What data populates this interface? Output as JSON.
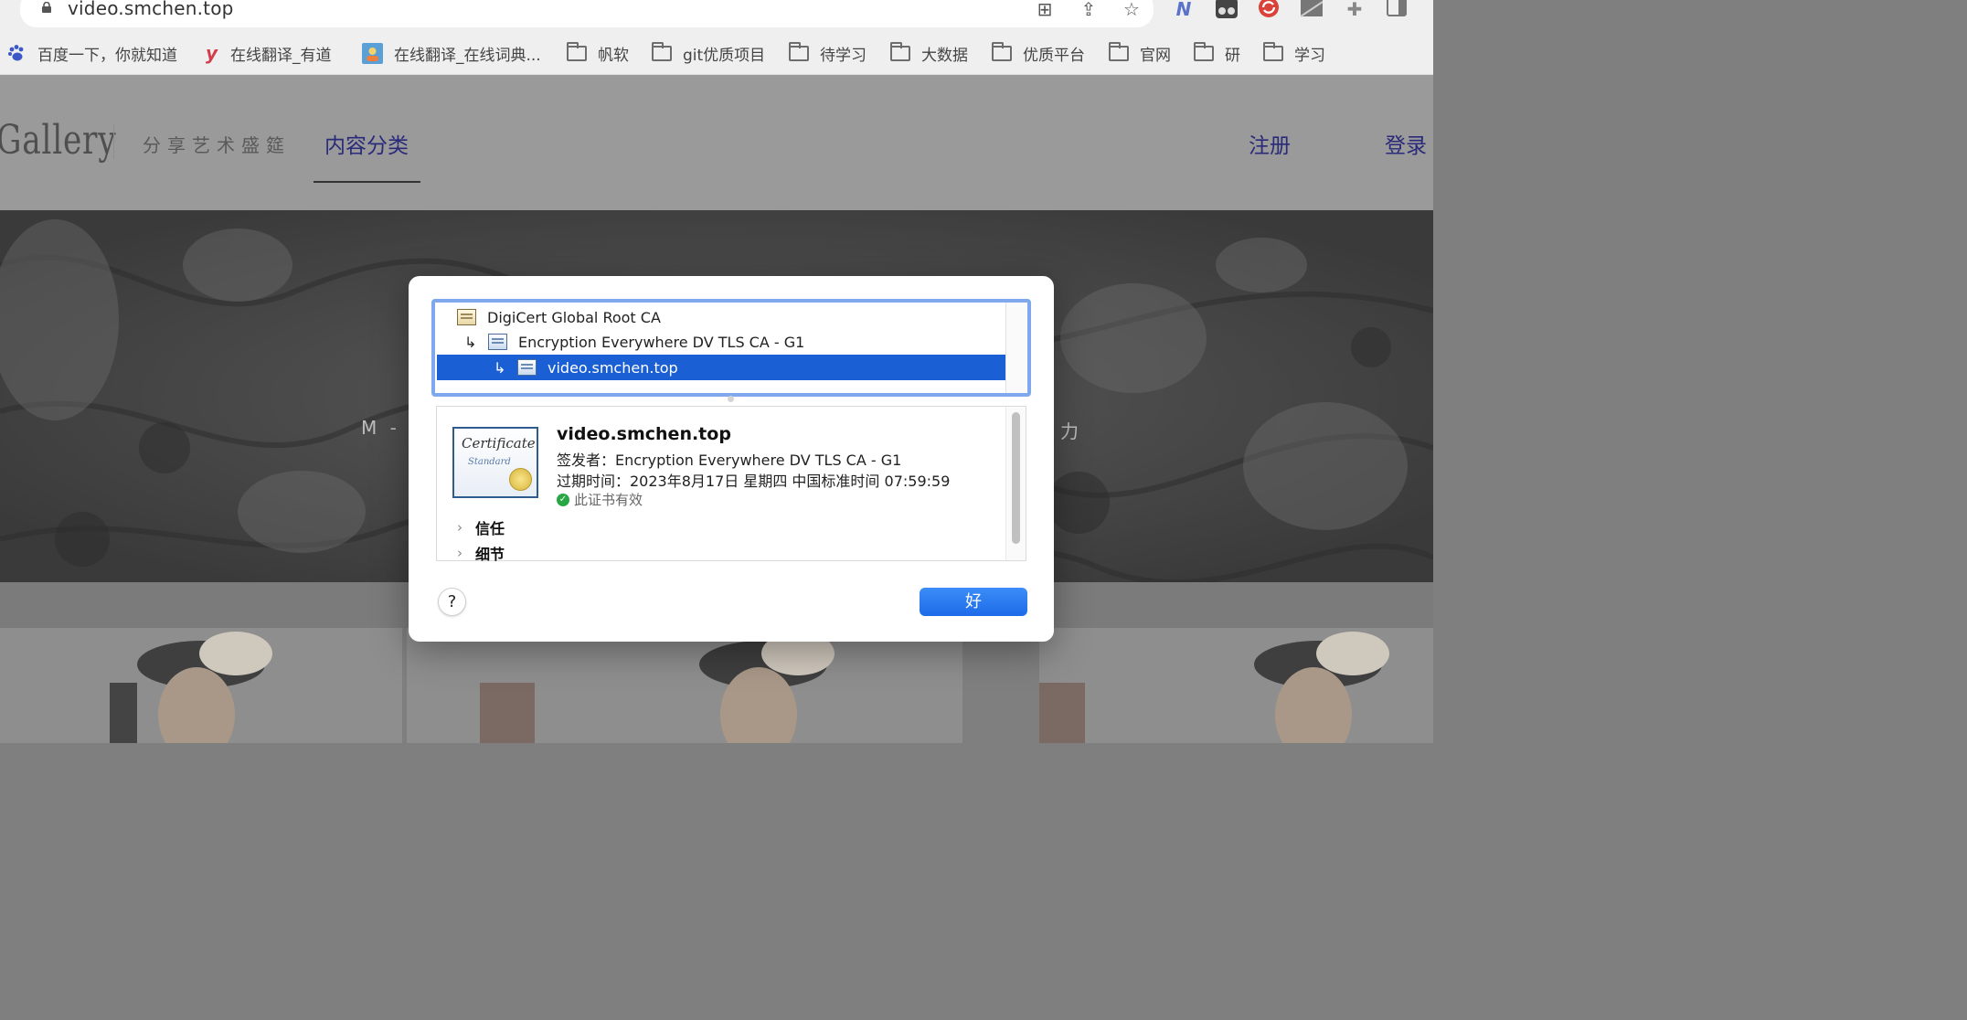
{
  "browser": {
    "url": "video.smchen.top",
    "extensions": [
      "translate-icon",
      "share-icon",
      "star-icon",
      "n-extension-icon",
      "tampermonkey-icon",
      "sync-icon",
      "grid-extension-icon",
      "puzzle-icon",
      "sidebar-icon"
    ]
  },
  "bookmarks": [
    {
      "label": "百度一下，你就知道",
      "icon": "baidu-paw-icon"
    },
    {
      "label": "在线翻译_有道",
      "icon": "youdao-icon"
    },
    {
      "label": "在线翻译_在线词典...",
      "icon": "dict-icon"
    },
    {
      "label": "帆软",
      "icon": "folder-icon"
    },
    {
      "label": "git优质项目",
      "icon": "folder-icon"
    },
    {
      "label": "待学习",
      "icon": "folder-icon"
    },
    {
      "label": "大数据",
      "icon": "folder-icon"
    },
    {
      "label": "优质平台",
      "icon": "folder-icon"
    },
    {
      "label": "官网",
      "icon": "folder-icon"
    },
    {
      "label": "研",
      "icon": "folder-icon"
    },
    {
      "label": "学习",
      "icon": "folder-icon"
    }
  ],
  "site": {
    "logo": "Gallery",
    "tagline": "分享艺术盛筵",
    "nav_category": "内容分类",
    "nav_register": "注册",
    "nav_login": "登录",
    "hero_left": "M - G",
    "hero_right": "力"
  },
  "dialog": {
    "chain": [
      {
        "label": "DigiCert Global Root CA",
        "selected": false
      },
      {
        "label": "Encryption Everywhere DV TLS CA - G1",
        "selected": false
      },
      {
        "label": "video.smchen.top",
        "selected": true
      }
    ],
    "cert_image_title": "Certificate",
    "cert_image_sub": "Standard",
    "common_name": "video.smchen.top",
    "issuer": "签发者：Encryption Everywhere DV TLS CA - G1",
    "expiry": "过期时间：2023年8月17日 星期四 中国标准时间 07:59:59",
    "valid_text": "此证书有效",
    "sections": [
      "信任",
      "细节"
    ],
    "help_label": "?",
    "ok_label": "好"
  },
  "colors": {
    "selection": "#1a5fd3",
    "focus_ring": "#7fa8ee",
    "ok_button": "#1d6ae8",
    "valid_green": "#28a745",
    "nav_link": "#2a2a7a"
  }
}
